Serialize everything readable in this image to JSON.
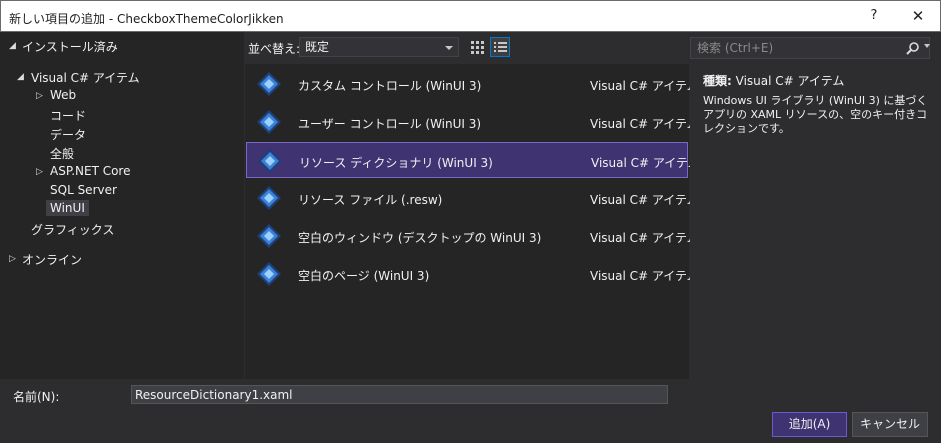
{
  "window": {
    "title": "新しい項目の追加 - CheckboxThemeColorJikken",
    "help": "?",
    "close": "✕"
  },
  "tree": {
    "installed": "インストール済み",
    "visual_csharp": "Visual C# アイテム",
    "web": "Web",
    "code": "コード",
    "data": "データ",
    "general": "全般",
    "aspnet": "ASP.NET Core",
    "sql": "SQL Server",
    "winui": "WinUI",
    "graphics": "グラフィックス",
    "online": "オンライン"
  },
  "toolbar": {
    "sort_label": "並べ替え:",
    "sort_value": "既定"
  },
  "search": {
    "placeholder": "検索 (Ctrl+E)"
  },
  "templates": [
    {
      "name": "カスタム コントロール (WinUI 3)",
      "lang": "Visual C# アイテム"
    },
    {
      "name": "ユーザー コントロール (WinUI 3)",
      "lang": "Visual C# アイテム"
    },
    {
      "name": "リソース ディクショナリ (WinUI 3)",
      "lang": "Visual C# アイテム"
    },
    {
      "name": "リソース ファイル (.resw)",
      "lang": "Visual C# アイテム"
    },
    {
      "name": "空白のウィンドウ (デスクトップの WinUI 3)",
      "lang": "Visual C# アイテム"
    },
    {
      "name": "空白のページ (WinUI 3)",
      "lang": "Visual C# アイテム"
    }
  ],
  "details": {
    "kind_label": "種類:",
    "kind_value": "Visual C# アイテム",
    "description": "Windows UI ライブラリ (WinUI 3) に基づくアプリの XAML リソースの、空のキー付きコレクションです。"
  },
  "footer": {
    "name_label": "名前(N):",
    "name_value": "ResourceDictionary1.xaml",
    "add_button": "追加(A)",
    "cancel_button": "キャンセル"
  },
  "colors": {
    "accent": "#3f3371",
    "background": "#2d2d30",
    "pane": "#252526"
  }
}
